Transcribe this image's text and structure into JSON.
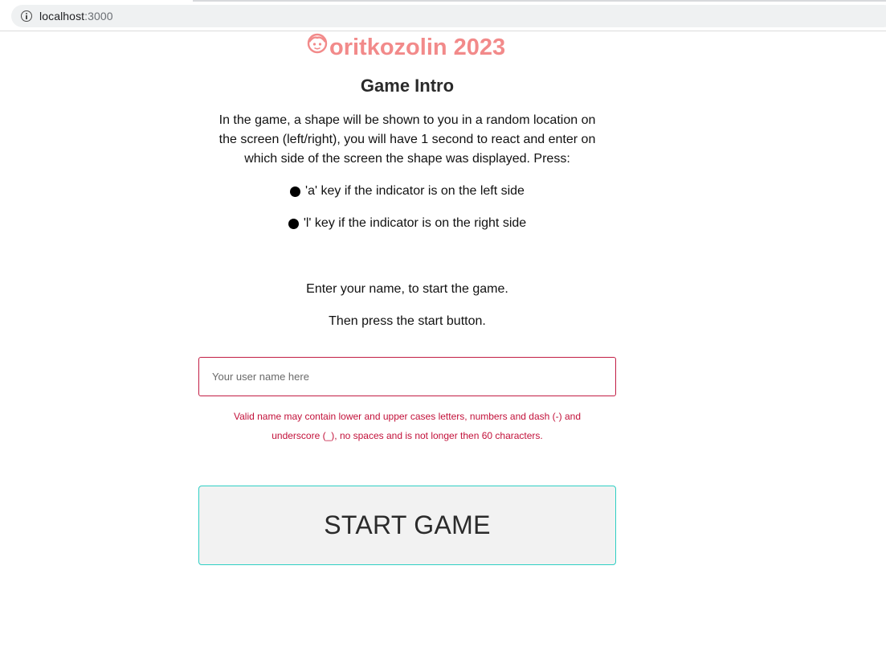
{
  "browser": {
    "url_host": "localhost",
    "url_port": ":3000"
  },
  "brand": {
    "text": "oritkozolin 2023",
    "icon": "face-icon",
    "color": "#f28a8a"
  },
  "intro": {
    "title": "Game Intro",
    "description": "In the game, a shape will be shown to you in a random location on the screen (left/right), you will have 1 second to react and enter on which side of the screen the shape was displayed. Press:",
    "rules": [
      "'a' key if the indicator is on the left side",
      "'l' key if the indicator is on the right side"
    ]
  },
  "form": {
    "instruction_1": "Enter your name, to start the game.",
    "instruction_2": "Then press the start button.",
    "name_placeholder": "Your user name here",
    "name_value": "",
    "validation_message": "Valid name may contain lower and upper cases letters, numbers and dash (-) and underscore (_), no spaces and is not longer then 60 characters.",
    "error_color": "#c2113a",
    "start_label": "START GAME",
    "start_border_color": "#2fcfc4"
  }
}
